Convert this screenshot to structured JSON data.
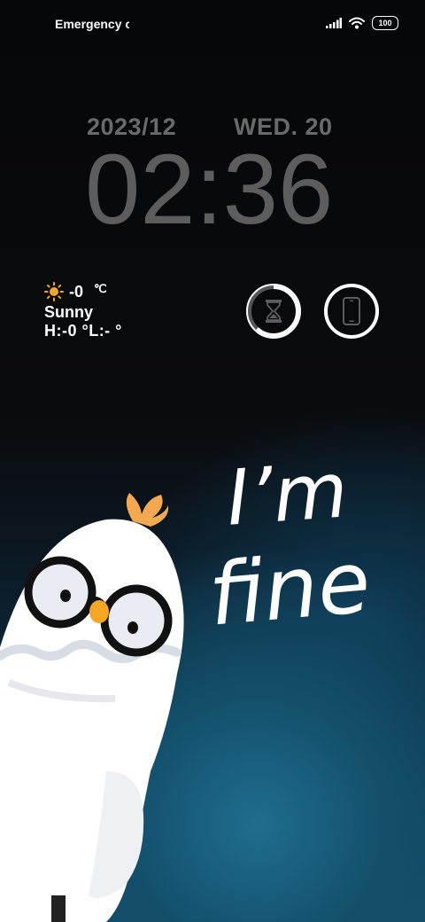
{
  "status_bar": {
    "carrier": "Emergency calls only",
    "battery": "100",
    "icons": [
      "signal-icon",
      "wifi-icon",
      "battery-icon"
    ]
  },
  "clock": {
    "date": "2023/12",
    "weekday": "WED. 20",
    "time": "02:36"
  },
  "weather": {
    "icon": "sun-icon",
    "temp": "-0",
    "unit": "℃",
    "condition": "Sunny",
    "high_low": "H:-0 °L:-   °"
  },
  "widgets": [
    {
      "name": "timer-widget",
      "icon": "hourglass-icon",
      "progress": 0.62
    },
    {
      "name": "phone-widget",
      "icon": "phone-icon"
    }
  ],
  "wallpaper": {
    "tagline_1": "I’m",
    "tagline_2": "fine",
    "colors": {
      "accent": "#1f6d8f",
      "beak": "#f5a623",
      "clock": "#5d5d5d"
    }
  }
}
